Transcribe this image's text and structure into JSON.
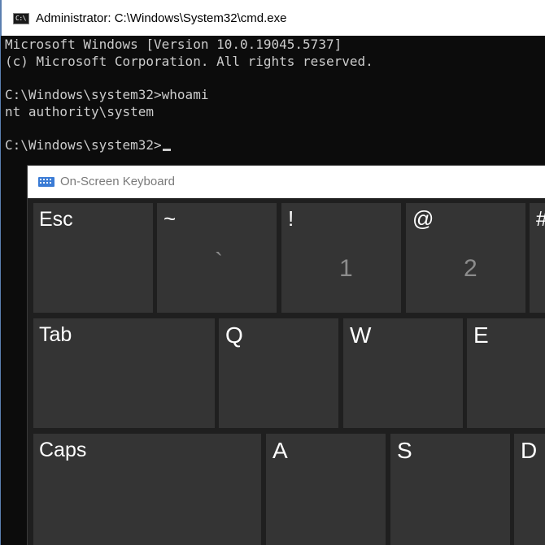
{
  "cmd": {
    "title": "Administrator: C:\\Windows\\System32\\cmd.exe",
    "lines": [
      "Microsoft Windows [Version 10.0.19045.5737]",
      "(c) Microsoft Corporation. All rights reserved.",
      "",
      "C:\\Windows\\system32>whoami",
      "nt authority\\system",
      "",
      "C:\\Windows\\system32>"
    ]
  },
  "osk": {
    "title": "On-Screen Keyboard",
    "row1": {
      "esc": "Esc",
      "tilde_shift": "~",
      "tilde_base": "`",
      "k1_shift": "!",
      "k1_base": "1",
      "k2_shift": "@",
      "k2_base": "2",
      "k3_shift": "#"
    },
    "row2": {
      "tab": "Tab",
      "q": "Q",
      "w": "W",
      "e": "E"
    },
    "row3": {
      "caps": "Caps",
      "a": "A",
      "s": "S",
      "d": "D"
    }
  }
}
